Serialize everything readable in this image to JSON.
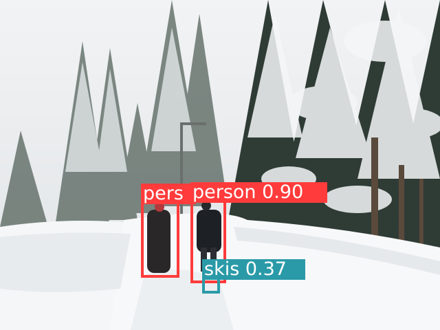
{
  "image": {
    "description_free": true,
    "colors": {
      "sky": "#eef0f2",
      "snow": "#f6f7f8",
      "tree_dark": "#2f3b35",
      "person_box": "#ff3b3b",
      "skis_box": "#2a9aa8"
    }
  },
  "detections": [
    {
      "class": "person",
      "label": "pers",
      "color": "#ff3b3b"
    },
    {
      "class": "person",
      "label": "person  0.90",
      "color": "#ff3b3b"
    },
    {
      "class": "skis",
      "label": "skis  0.37",
      "color": "#2a9aa8"
    }
  ]
}
